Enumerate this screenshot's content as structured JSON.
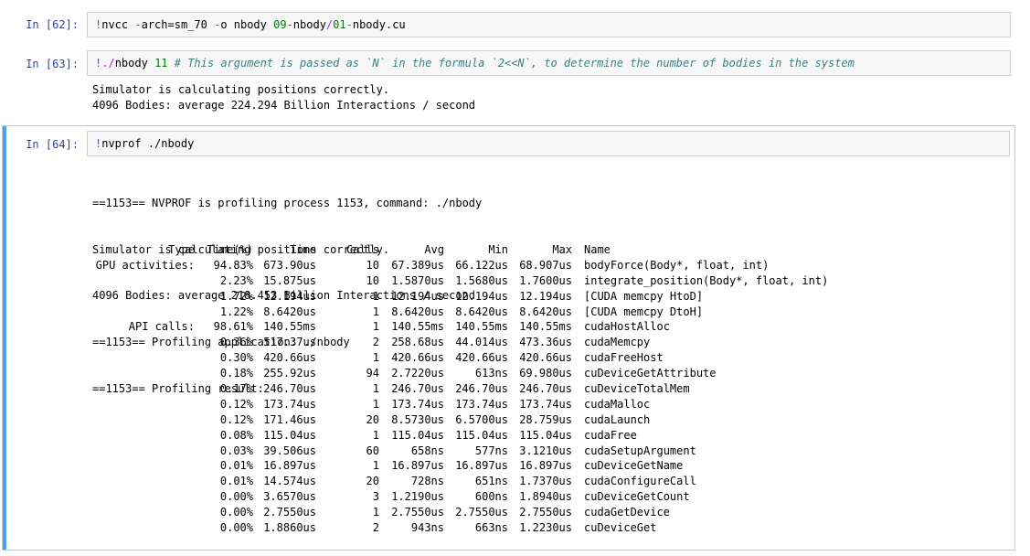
{
  "cells": [
    {
      "prompt": "In  [62]:",
      "code": {
        "bang": "!",
        "p1": "nvcc ",
        "p2": "-",
        "p3": "arch=sm_70 ",
        "p4": "-",
        "p5": "o nbody ",
        "n1": "09",
        "p6": "-",
        "p7": "nbody",
        "p8": "/",
        "n2": "01",
        "p9": "-",
        "p10": "nbody.cu"
      }
    },
    {
      "prompt": "In  [63]:",
      "code": {
        "bang": "!",
        "dot": ".",
        "slash": "/",
        "p1": "nbody ",
        "n1": "11",
        "comment": " # This argument is passed as `N` in the formula `2<<N`, to determine the number of bodies in the system"
      },
      "output": [
        "Simulator is calculating positions correctly.",
        "4096 Bodies: average 224.294 Billion Interactions / second"
      ]
    },
    {
      "prompt": "In  [64]:",
      "code": {
        "bang": "!",
        "p1": "nvprof ./nbody"
      },
      "output": [
        "==1153== NVPROF is profiling process 1153, command: ./nbody",
        "Simulator is calculating positions correctly.",
        "4096 Bodies: average 218.453 Billion Interactions / second",
        "==1153== Profiling application: ./nbody",
        "==1153== Profiling result:"
      ],
      "profile": {
        "headers": [
          "Type",
          "Time(%)",
          "Time",
          "Calls",
          "Avg",
          "Min",
          "Max",
          "Name"
        ],
        "rows": [
          [
            "GPU activities:",
            "94.83%",
            "673.90us",
            "10",
            "67.389us",
            "66.122us",
            "68.907us",
            "bodyForce(Body*, float, int)"
          ],
          [
            "",
            "2.23%",
            "15.875us",
            "10",
            "1.5870us",
            "1.5680us",
            "1.7600us",
            "integrate_position(Body*, float, int)"
          ],
          [
            "",
            "1.72%",
            "12.194us",
            "1",
            "12.194us",
            "12.194us",
            "12.194us",
            "[CUDA memcpy HtoD]"
          ],
          [
            "",
            "1.22%",
            "8.6420us",
            "1",
            "8.6420us",
            "8.6420us",
            "8.6420us",
            "[CUDA memcpy DtoH]"
          ],
          [
            "API calls:",
            "98.61%",
            "140.55ms",
            "1",
            "140.55ms",
            "140.55ms",
            "140.55ms",
            "cudaHostAlloc"
          ],
          [
            "",
            "0.36%",
            "517.37us",
            "2",
            "258.68us",
            "44.014us",
            "473.36us",
            "cudaMemcpy"
          ],
          [
            "",
            "0.30%",
            "420.66us",
            "1",
            "420.66us",
            "420.66us",
            "420.66us",
            "cudaFreeHost"
          ],
          [
            "",
            "0.18%",
            "255.92us",
            "94",
            "2.7220us",
            "613ns",
            "69.980us",
            "cuDeviceGetAttribute"
          ],
          [
            "",
            "0.17%",
            "246.70us",
            "1",
            "246.70us",
            "246.70us",
            "246.70us",
            "cuDeviceTotalMem"
          ],
          [
            "",
            "0.12%",
            "173.74us",
            "1",
            "173.74us",
            "173.74us",
            "173.74us",
            "cudaMalloc"
          ],
          [
            "",
            "0.12%",
            "171.46us",
            "20",
            "8.5730us",
            "6.5700us",
            "28.759us",
            "cudaLaunch"
          ],
          [
            "",
            "0.08%",
            "115.04us",
            "1",
            "115.04us",
            "115.04us",
            "115.04us",
            "cudaFree"
          ],
          [
            "",
            "0.03%",
            "39.506us",
            "60",
            "658ns",
            "577ns",
            "3.1210us",
            "cudaSetupArgument"
          ],
          [
            "",
            "0.01%",
            "16.897us",
            "1",
            "16.897us",
            "16.897us",
            "16.897us",
            "cuDeviceGetName"
          ],
          [
            "",
            "0.01%",
            "14.574us",
            "20",
            "728ns",
            "651ns",
            "1.7370us",
            "cudaConfigureCall"
          ],
          [
            "",
            "0.00%",
            "3.6570us",
            "3",
            "1.2190us",
            "600ns",
            "1.8940us",
            "cuDeviceGetCount"
          ],
          [
            "",
            "0.00%",
            "2.7550us",
            "1",
            "2.7550us",
            "2.7550us",
            "2.7550us",
            "cudaGetDevice"
          ],
          [
            "",
            "0.00%",
            "1.8860us",
            "2",
            "943ns",
            "663ns",
            "1.2230us",
            "cuDeviceGet"
          ]
        ]
      }
    }
  ],
  "colors": {
    "prompt": "#303f9f",
    "selected_bar": "#42a5f5",
    "number": "#008000",
    "magic": "#aa22ff",
    "comment": "#408080"
  }
}
